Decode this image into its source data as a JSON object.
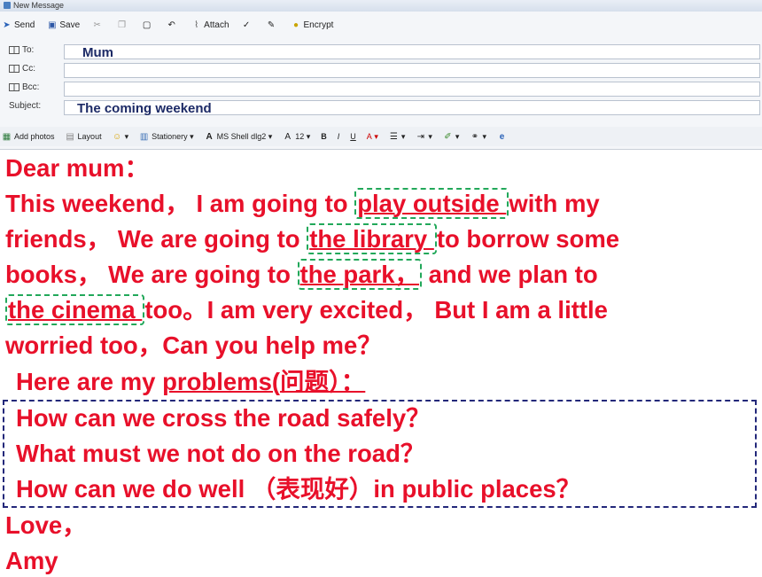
{
  "window": {
    "title": "New Message"
  },
  "toolbar": {
    "send": "Send",
    "save": "Save",
    "attach": "Attach",
    "encrypt": "Encrypt"
  },
  "fields": {
    "to_label": "To:",
    "to_value": "Mum",
    "cc_label": "Cc:",
    "cc_value": "",
    "bcc_label": "Bcc:",
    "bcc_value": "",
    "subject_label": "Subject:",
    "subject_value": "The coming weekend"
  },
  "format_bar": {
    "add_photos": "Add photos",
    "layout": "Layout",
    "stationery": "Stationery",
    "font_name": "MS Shell dlg2",
    "font_size": "12",
    "bold": "B",
    "italic": "I",
    "underline": "U",
    "font_color": "A"
  },
  "letter": {
    "greeting": "Dear mum：",
    "l1_a": "This weekend， I am going to ",
    "l1_b": "play outside ",
    "l1_c": "with my",
    "l2_a": "friends， We are going to ",
    "l2_b": "the library ",
    "l2_c": "to borrow some",
    "l3_a": "books， We are going to ",
    "l3_b": "the park，",
    "l3_c": " and we plan to",
    "l4_a": "the cinema ",
    "l4_b": "too。I am very excited， But I am a little",
    "l5": "worried too，Can you help me？",
    "problems_intro_a": "Here are  my ",
    "problems_intro_b": "problems(问题）：",
    "q1": "How can we cross the road safely？",
    "q2": "What must we not do on the road？",
    "q3": "How can we do well （表现好）in public places？",
    "closing": "Love，",
    "signature": "Amy"
  },
  "colors": {
    "text": "#e8102a",
    "green_box": "#22a85a",
    "blue_box": "#23287a"
  }
}
